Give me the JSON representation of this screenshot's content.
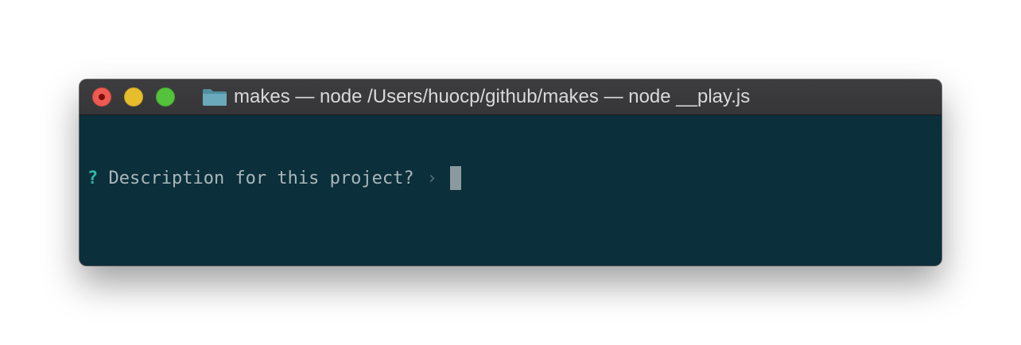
{
  "window": {
    "title": "makes — node /Users/huocp/github/makes — node __play.js",
    "title_icon": "folder-icon"
  },
  "terminal": {
    "prompt_symbol": "?",
    "question": "Description for this project?",
    "separator": "›",
    "input_value": ""
  },
  "colors": {
    "terminal_background": "#0b2f3b",
    "prompt_symbol": "#2fb8a8",
    "question_text": "#a9b7bb",
    "close_light": "#ee5a52",
    "minimize_light": "#e6bd2c",
    "zoom_light": "#55c23c"
  }
}
